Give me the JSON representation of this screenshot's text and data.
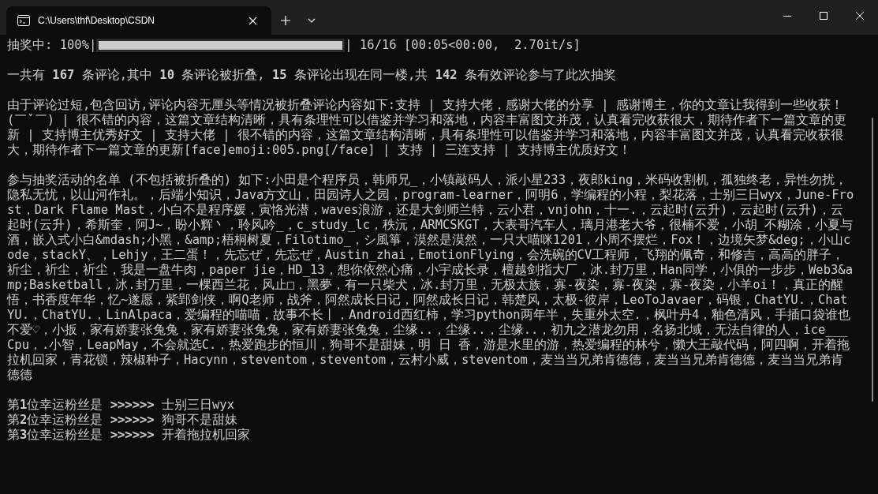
{
  "window": {
    "tab_title": "C:\\Users\\thf\\Desktop\\CSDN"
  },
  "terminal": {
    "progress": {
      "label": "抽奖中: 100%|",
      "level": 1,
      "stats": "| 16/16 [00:05<00:00,  2.70it/s]"
    },
    "summary": "一共有 **167** 条评论,其中 **10** 条评论被折叠, **15** 条评论出现在同一楼,共 **142** 条有效评论参与了此次抽奖",
    "folded_comments": "由于评论过短,包含回访,评论内容无厘头等情况被折叠评论内容如下:支持 | 支持大佬，感谢大佬的分享 | 感谢博主，你的文章让我得到一些收获！(￣ˇ￣) | 很不错的内容，这篇文章结构清晰，具有条理性可以借鉴并学习和落地，内容丰富图文并茂，认真看完收获很大，期待作者下一篇文章的更新 | 支持博主优秀好文 | 支持大佬 | 很不错的内容，这篇文章结构清晰，具有条理性可以借鉴并学习和落地，内容丰富图文并茂，认真看完收获很大，期待作者下一篇文章的更新[face]emoji:005.png[/face] | 支持 | 三连支持 | 支持博主优质好文！",
    "participants": "参与抽奖活动的名单 (不包括被折叠的) 如下:小田是个程序员，韩师兄_，小镇敲码人，派小星233，夜郎king，米码收割机，孤独终老，异性勿扰，隐私无忧，以山河作礼。，后端小知识，Java方文山，田园诗人之园，program-learner，阿明6，学编程的小程，梨花落，士别三日wyx，June-Frost，Dark Flame Mast，小白不是程序媛，寅恪光潜，waves浪游，还是大剑师兰特，云小君，vnjohn，十一.，云起时(云升)，云起时(云升)，云起时(云升)，希斯奎，阿J~，盼小辉丶，聆风吟_，c_study_lc，秩沅，ARMCSKGT，大表哥汽车人，璃月港老大爷，很楠不爱，小胡_不糊涂，小夏与酒，嵌入式小白&mdash;小黑，&amp;梧桐树夏，Filotimo_，シ風箏，漠然是漠然，一只大喵咪1201，小周不摆烂，Fox！，边境矢梦&deg;，小山code，stackY、，Lehjy，王二蛋！，先忘ぜ，先忘ぜ，Austin_zhai，EmotionFlying，会洗碗的CV工程师，飞翔的佩奇，和修吉，高高的胖子，祈尘，祈尘，祈尘，我是一盘牛肉，paper jie，HD_13，想你依然心痛，小宇成长录，檀越剑指大厂，冰.封万里，Han同学，小俱的一步步，Web3&amp;Basketball，冰.封万里，一棵西兰花，风止□，黑夢，有一只柴犬，冰.封万里，无极太族，寡-夜染，寡-夜染，寡-夜染，小羊oi！，真正的醒悟，书香度年华，忆~遂愿，紫郢剑侠，啊Q老师，战斧，阿然成长日记，阿然成长日记，韩楚风，太极-彼岸，LeoToJavaer，码银，ChatYU.，ChatYU.，ChatYU.，LinAlpaca，爱编程的喵喵，故事不长丨，Android西红柿，学习python两年半，失重外太空.，枫叶丹4，釉色清风，手插口袋谁也不爱♡，小扳，家有娇妻张兔兔，家有娇妻张兔兔，家有娇妻张兔兔，尘缘..，尘缘..，尘缘..，初九之潜龙勿用，名扬北域，无法自律的人，ice___Cpu，.小智，LeapMay，不会就选C.，热爱跑步的恒川，狗哥不是甜妹，明 日 香，游是水里的游，热爱编程的林兮，懒大王敲代码，阿四啊，开着拖拉机回家，青花锁，辣椒种子，Hacynn，steventom，steventom，云村小威，steventom，麦当当兄弟肯德德，麦当当兄弟肯德德，麦当当兄弟肯德德",
    "winners": [
      "第**1**位幸运粉丝是 **>>>>>>** 士别三日wyx",
      "第**2**位幸运粉丝是 **>>>>>>** 狗哥不是甜妹",
      "第**3**位幸运粉丝是 **>>>>>>** 开着拖拉机回家"
    ]
  }
}
